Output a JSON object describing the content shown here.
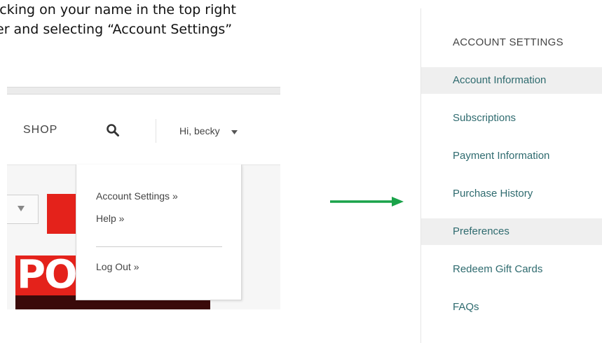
{
  "instructions": {
    "line1": "icking on your name in the top right",
    "line2": "er and selecting “Account Settings”"
  },
  "site": {
    "nav_shop": "SHOP",
    "greeting": "Hi, becky",
    "search_icon": "search-icon",
    "caret_icon": "chevron-down-icon",
    "menu": {
      "account_settings": "Account Settings »",
      "help": "Help »",
      "log_out": "Log Out »"
    },
    "magazine_title": "POPULAR"
  },
  "panel": {
    "header": "ACCOUNT SETTINGS",
    "items": [
      {
        "label": "Account Information",
        "highlighted": true
      },
      {
        "label": "Subscriptions",
        "highlighted": false
      },
      {
        "label": "Payment Information",
        "highlighted": false
      },
      {
        "label": "Purchase History",
        "highlighted": false
      },
      {
        "label": "Preferences",
        "highlighted": true
      },
      {
        "label": "Redeem Gift Cards",
        "highlighted": false
      },
      {
        "label": "FAQs",
        "highlighted": false
      }
    ]
  },
  "colors": {
    "arrow": "#1aa34a",
    "link_teal": "#2f6b6f",
    "red": "#e4221b",
    "highlight": "#efefef"
  }
}
